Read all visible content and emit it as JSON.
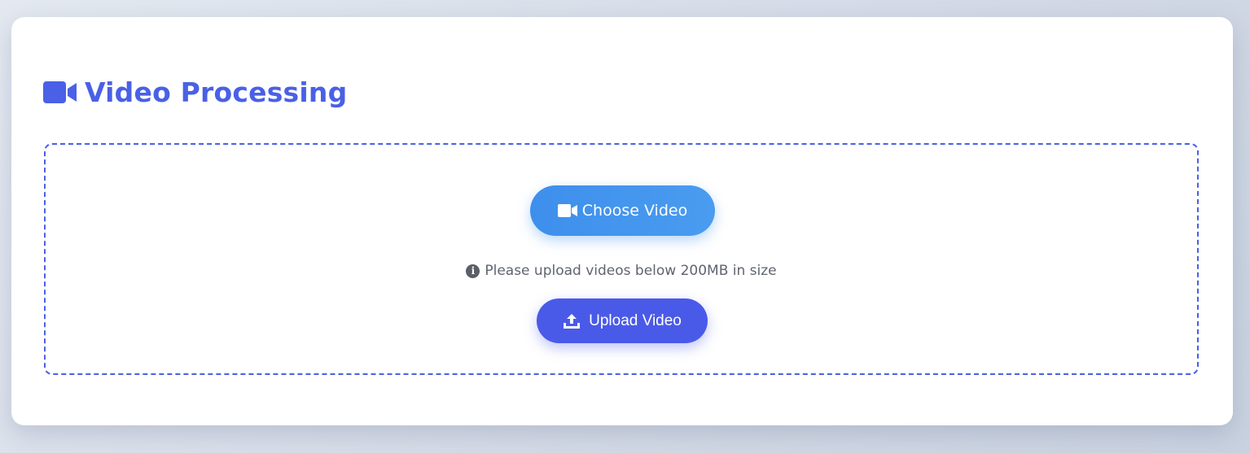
{
  "header": {
    "title": "Video Processing",
    "icon": "video-camera-icon",
    "accent_color": "#4a60e6"
  },
  "dropzone": {
    "choose_button": {
      "label": "Choose Video",
      "icon": "video-camera-icon",
      "color": "#3d8fec"
    },
    "hint": {
      "icon": "info-circle-icon",
      "text": "Please upload videos below 200MB in size"
    },
    "upload_button": {
      "label": "Upload Video",
      "icon": "upload-icon",
      "color": "#4a5ae8"
    }
  }
}
